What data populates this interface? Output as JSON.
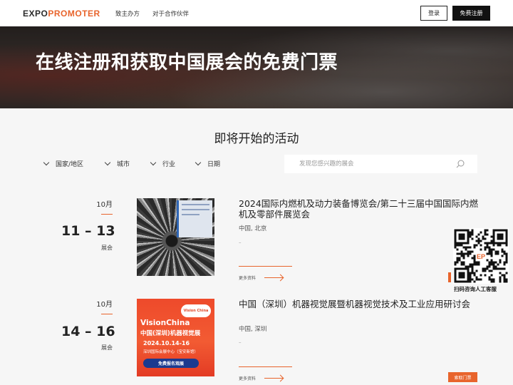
{
  "header": {
    "logo_main": "EXPO",
    "logo_accent": "PROMOTER",
    "nav": [
      "致主办方",
      "对于合作伙伴"
    ],
    "login_label": "登录",
    "register_label": "免费注册"
  },
  "hero": {
    "title": "在线注册和获取中国展会的免费门票"
  },
  "section": {
    "title": "即将开始的活动"
  },
  "filters": [
    "国家/地区",
    "城市",
    "行业",
    "日期"
  ],
  "search": {
    "placeholder": "发现您感兴趣的展会",
    "value": ""
  },
  "events": [
    {
      "month": "10月",
      "dates": "11 – 13",
      "type": "展会",
      "title": "2024国际内燃机及动力装备博览会/第二十三届中国国际内燃机及零部件展览会",
      "location": "中国, 北京",
      "dash": "–",
      "more_label": "更多资料",
      "image": "turbine-engine-photo"
    },
    {
      "month": "10月",
      "dates": "14 – 16",
      "type": "展会",
      "title": "中国（深圳）机器视觉展暨机器视觉技术及工业应用研讨会",
      "location": "中国, 深圳",
      "dash": "–",
      "more_label": "更多资料",
      "image": "vision-china-poster",
      "poster": {
        "badge": "Vision China",
        "heading_en": "VisionChina",
        "heading_cn": "中国(深圳)机器视觉展",
        "date": "2024.10.14-16",
        "venue": "深圳国际会展中心（宝安新馆）",
        "button": "免费报名观展"
      }
    }
  ],
  "qr_widget": {
    "label": "扫码咨询人工客服",
    "brand": "EP"
  },
  "free_ticket_label": "索取门票",
  "colors": {
    "accent": "#e8642c",
    "dark": "#111111",
    "background": "#f6f6f6"
  }
}
